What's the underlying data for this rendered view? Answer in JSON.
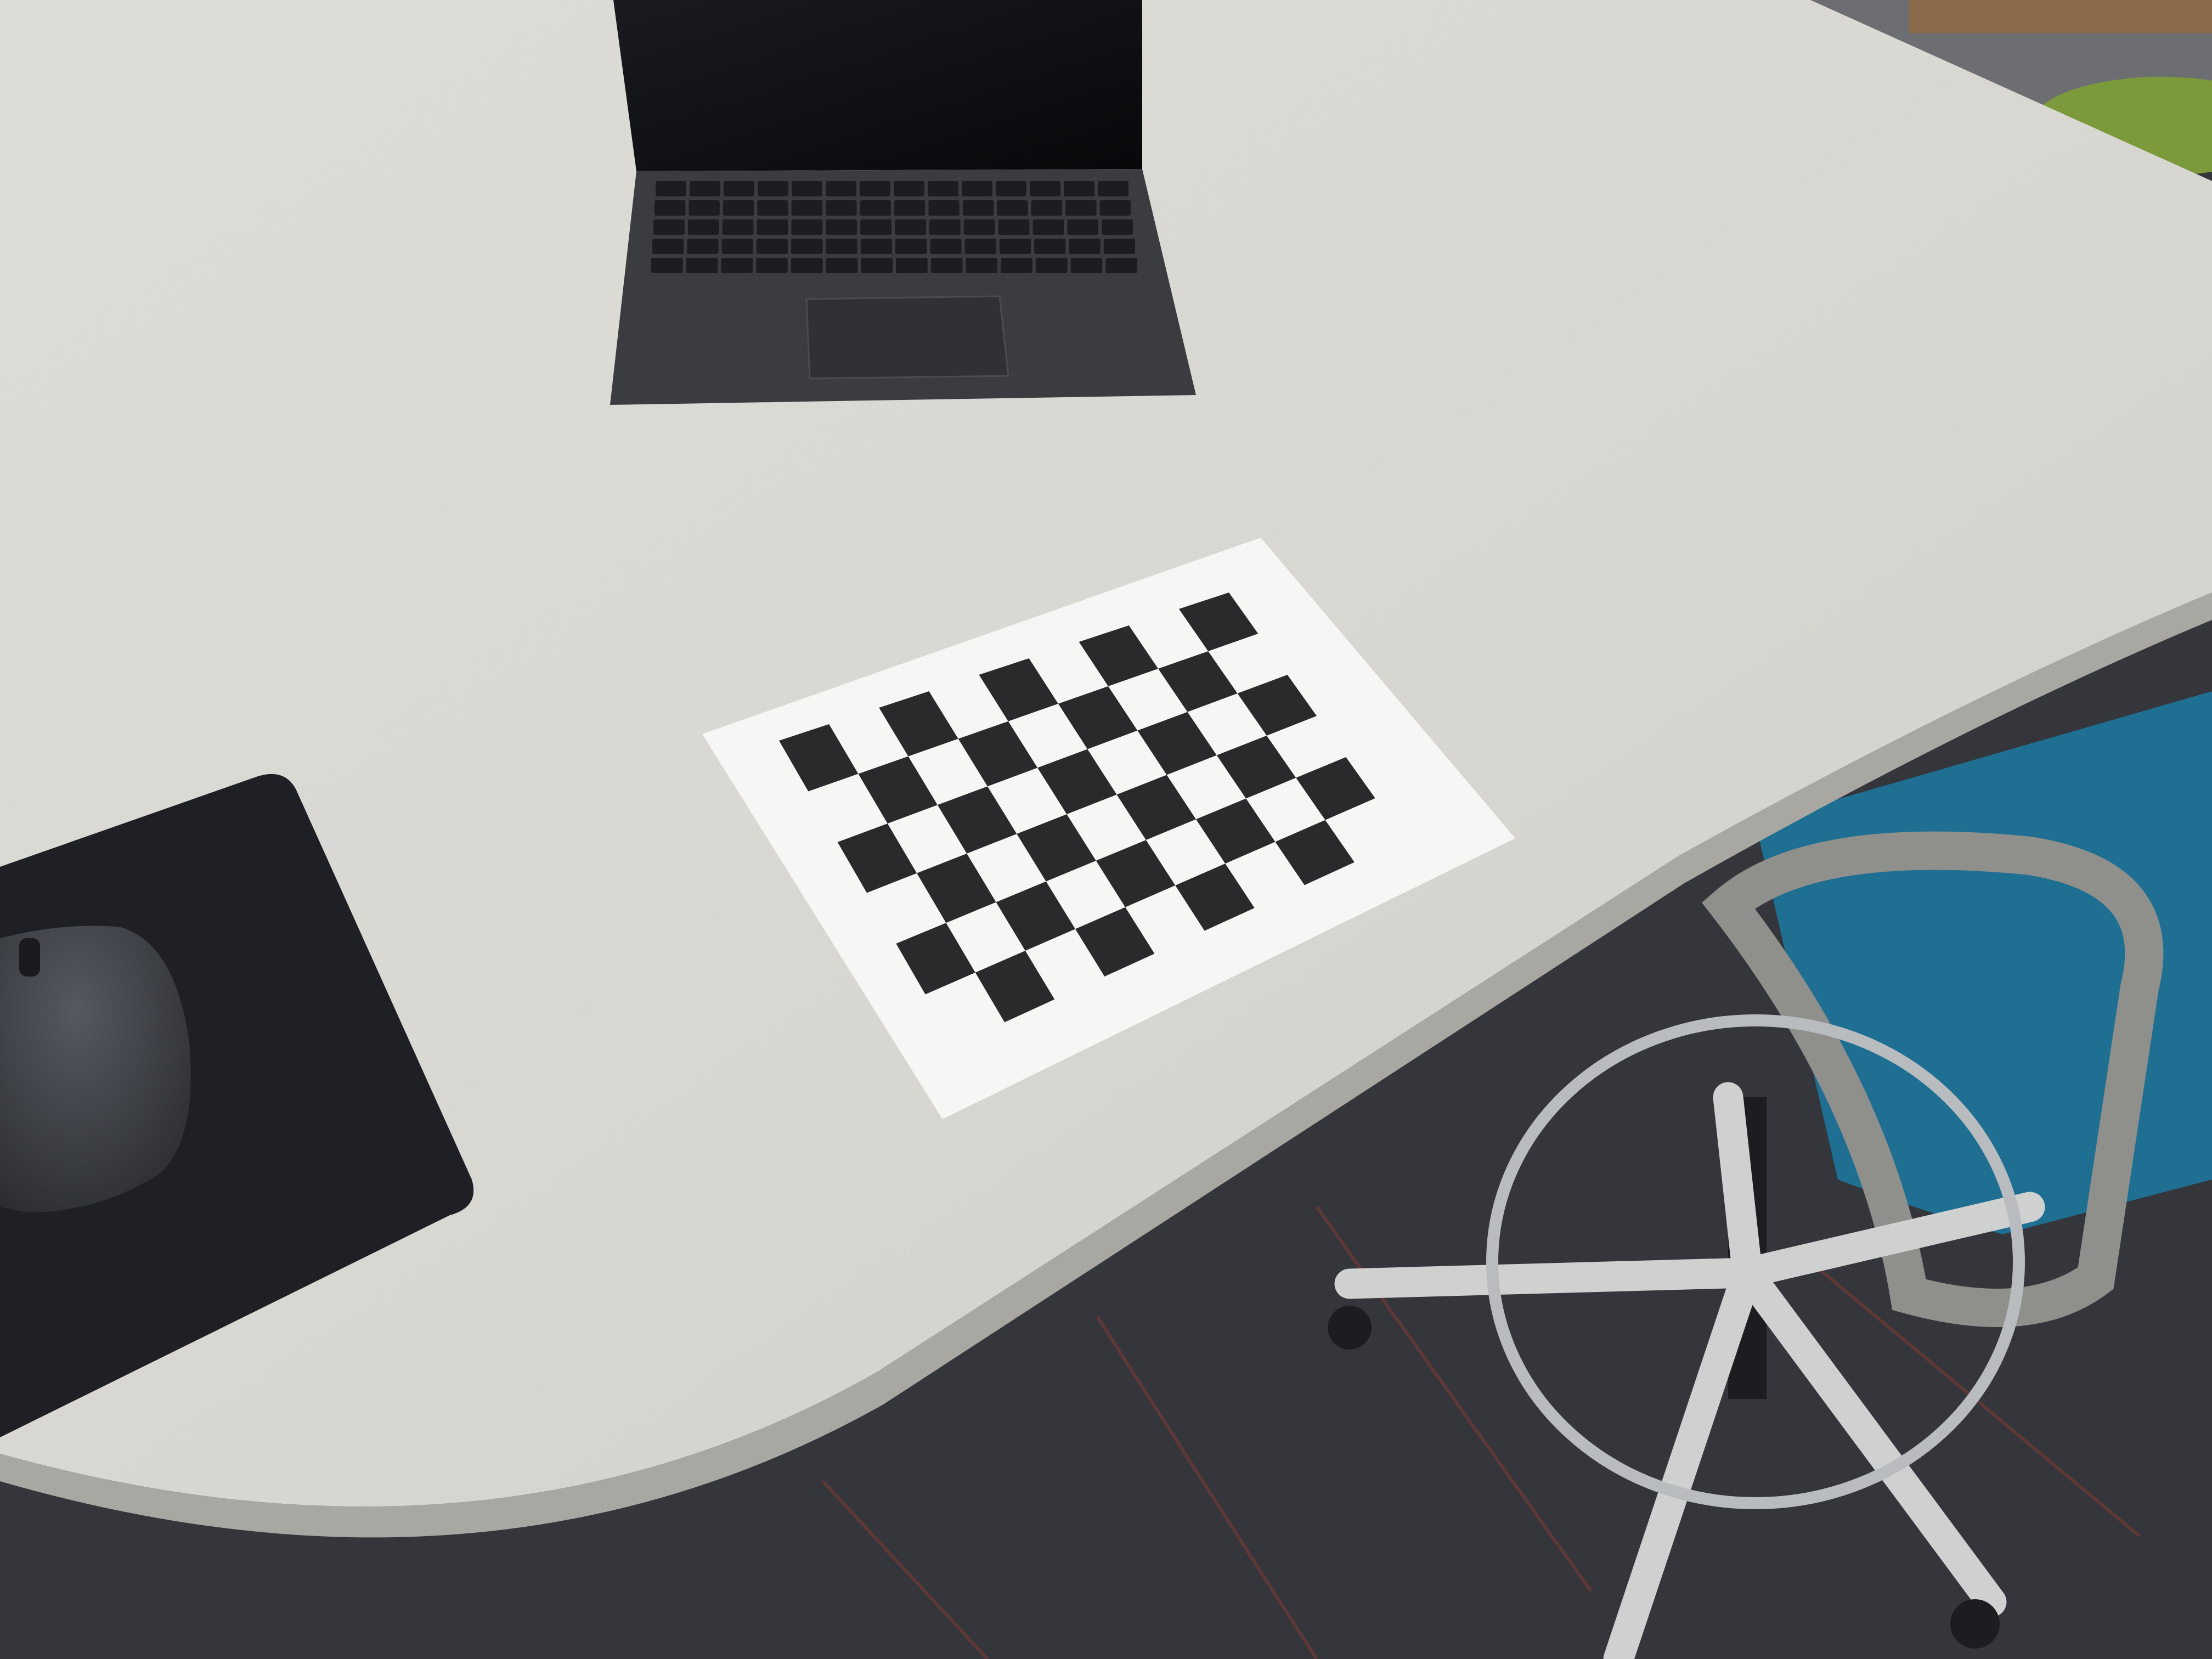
{
  "scene": {
    "description_free": true,
    "objects": {
      "desk_color": "#d9d7d2",
      "desk_edge_color": "#a9a7a2",
      "carpet_color": "#34363b",
      "carpet_stripe_color": "#7a3a34",
      "laptop_color": "#3a3c40",
      "laptop_screen_color": "#0e0f12",
      "keyboard_key_color": "#1c1d20",
      "trackpad_color": "#2f3135",
      "mousepad_color": "#1e2026",
      "mouse_color": "#3c3f44",
      "paper_color": "#f6f6f4",
      "checker_color": "#2a2a2c",
      "chair_seat_color": "#1f6f93",
      "chair_shell_color": "#8f8f8c",
      "chair_base_color": "#cfd1d0",
      "footring_color": "#b9bcbf",
      "green_chair_color": "#7a9a3c",
      "shelf_color": "#8a6a4a"
    },
    "checkerboard": {
      "rows": 6,
      "cols": 9
    }
  }
}
